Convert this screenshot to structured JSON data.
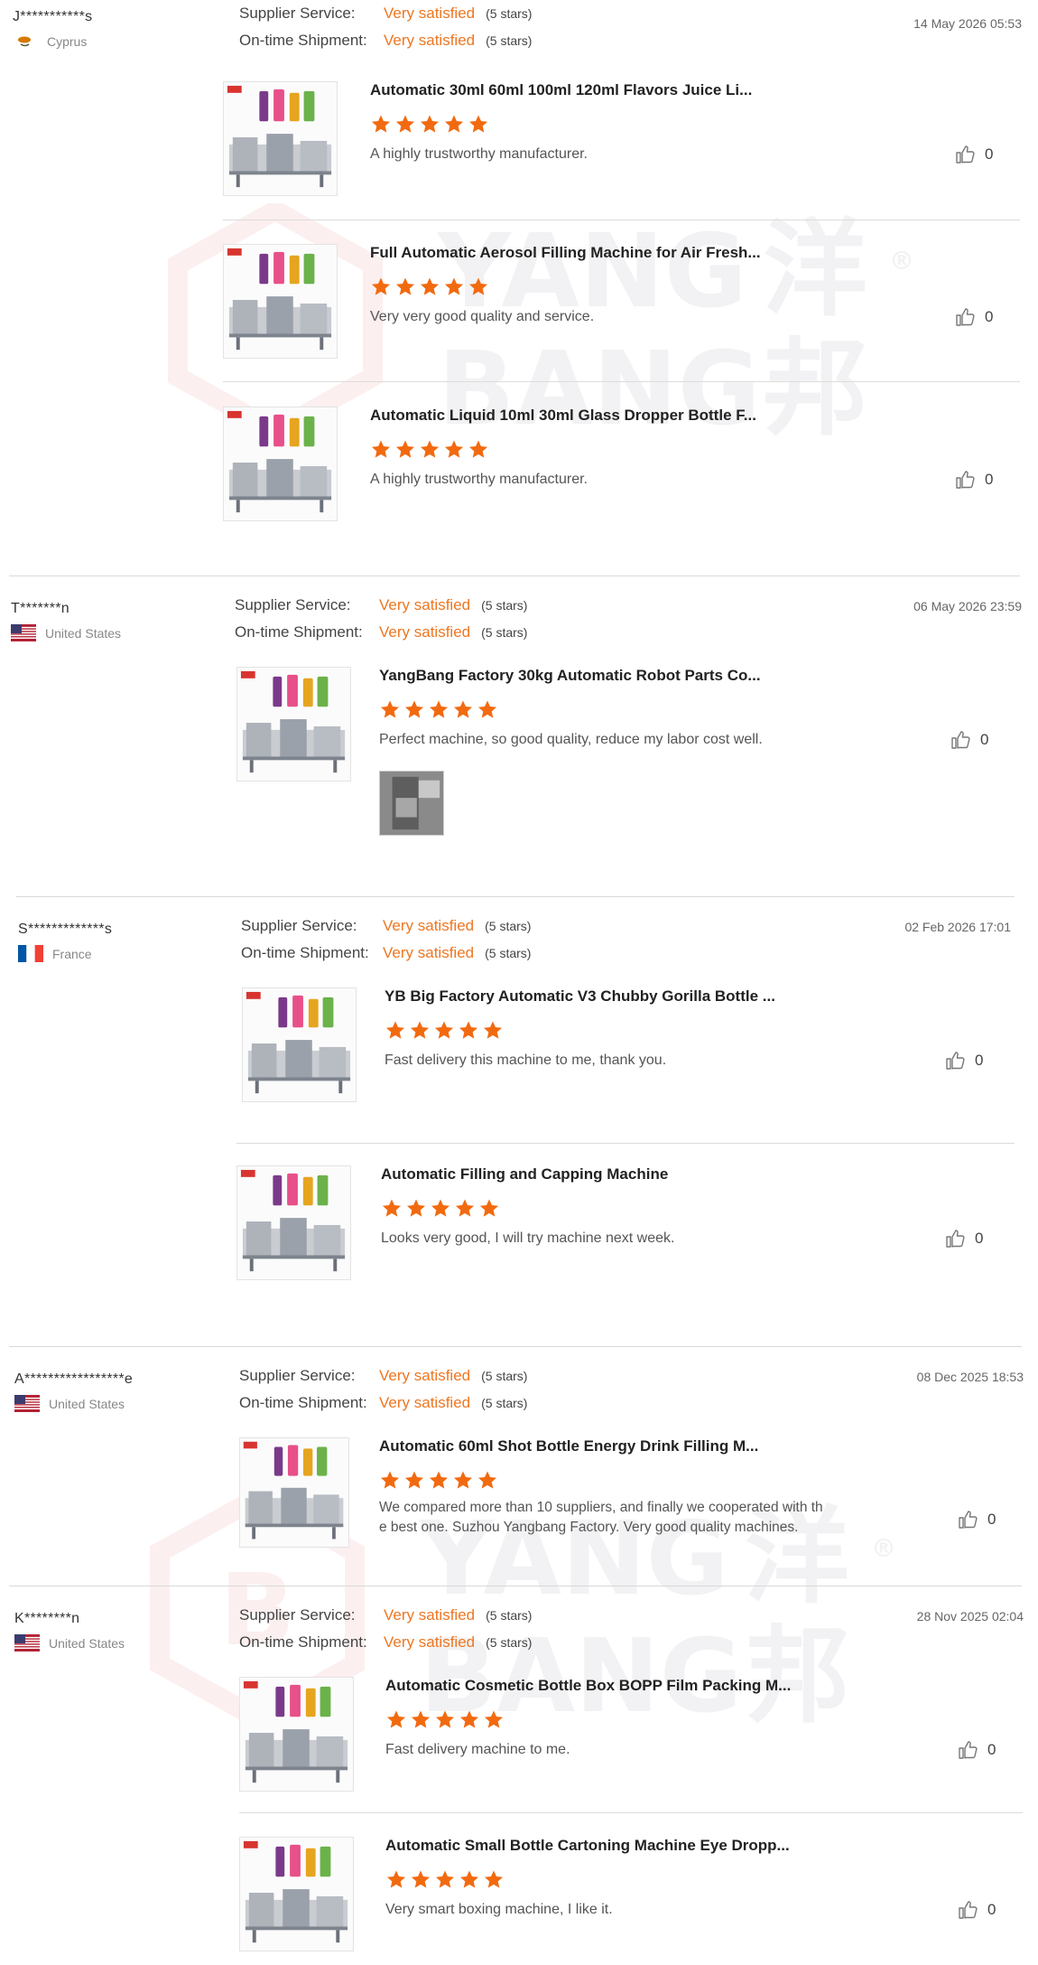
{
  "colors": {
    "accent": "#ee7621",
    "star": "#f26a10",
    "separator": "#d9d9d9"
  },
  "labels": {
    "supplier_service": "Supplier Service:",
    "ontime_shipment": "On-time Shipment:"
  },
  "watermark": {
    "latin_top": "YANG",
    "latin_bottom": "BANG",
    "cjk_top": "洋",
    "cjk_bottom": "邦",
    "registered": "®"
  },
  "reviews": [
    {
      "reviewer": "J***********s",
      "country": "Cyprus",
      "flag": "cyprus-flag",
      "date": "14 May 2026 05:53",
      "supplier_service": "Very satisfied",
      "supplier_stars": "(5 stars)",
      "shipment": "Very satisfied",
      "shipment_stars": "(5 stars)",
      "products": [
        {
          "title": "Automatic 30ml 60ml 100ml 120ml Flavors Juice Li...",
          "rating": 5,
          "comment": "A highly trustworthy manufacturer.",
          "likes": "0"
        },
        {
          "title": "Full Automatic Aerosol Filling Machine for Air Fresh...",
          "rating": 5,
          "comment": "Very very good quality and service.",
          "likes": "0"
        },
        {
          "title": "Automatic Liquid 10ml 30ml Glass Dropper Bottle F...",
          "rating": 5,
          "comment": "A highly trustworthy manufacturer.",
          "likes": "0"
        }
      ]
    },
    {
      "reviewer": "T*******n",
      "country": "United States",
      "flag": "usa-flag",
      "date": "06 May 2026 23:59",
      "supplier_service": "Very satisfied",
      "supplier_stars": "(5 stars)",
      "shipment": "Very satisfied",
      "shipment_stars": "(5 stars)",
      "products": [
        {
          "title": "YangBang Factory 30kg Automatic Robot Parts Co...",
          "rating": 5,
          "comment": "Perfect machine, so good quality, reduce my labor cost well.",
          "likes": "0"
        }
      ]
    },
    {
      "reviewer": "S*************s",
      "country": "France",
      "flag": "france-flag",
      "date": "02 Feb 2026 17:01",
      "supplier_service": "Very satisfied",
      "supplier_stars": "(5 stars)",
      "shipment": "Very satisfied",
      "shipment_stars": "(5 stars)",
      "products": [
        {
          "title": "YB Big Factory Automatic V3 Chubby Gorilla Bottle ...",
          "rating": 5,
          "comment": "Fast delivery this machine to me, thank you.",
          "likes": "0"
        },
        {
          "title": "Automatic Filling and Capping Machine",
          "rating": 5,
          "comment": "Looks very good, I will try machine next week.",
          "likes": "0"
        }
      ]
    },
    {
      "reviewer": "A*****************e",
      "country": "United States",
      "flag": "usa-flag",
      "date": "08 Dec 2025 18:53",
      "supplier_service": "Very satisfied",
      "supplier_stars": "(5 stars)",
      "shipment": "Very satisfied",
      "shipment_stars": "(5 stars)",
      "products": [
        {
          "title": "Automatic 60ml Shot Bottle Energy Drink Filling M...",
          "rating": 5,
          "comment_l1": "We compared more than 10 suppliers, and finally we cooperated with th",
          "comment_l2": "e best one. Suzhou Yangbang Factory. Very good quality machines.",
          "likes": "0"
        }
      ]
    },
    {
      "reviewer": "K********n",
      "country": "United States",
      "flag": "usa-flag",
      "date": "28 Nov 2025 02:04",
      "supplier_service": "Very satisfied",
      "supplier_stars": "(5 stars)",
      "shipment": "Very satisfied",
      "shipment_stars": "(5 stars)",
      "products": [
        {
          "title": "Automatic Cosmetic Bottle Box BOPP Film Packing M...",
          "rating": 5,
          "comment": "Fast delivery machine to me.",
          "likes": "0"
        },
        {
          "title": "Automatic Small Bottle Cartoning Machine Eye Dropp...",
          "rating": 5,
          "comment": "Very smart boxing machine, I like it.",
          "likes": "0"
        }
      ]
    }
  ]
}
